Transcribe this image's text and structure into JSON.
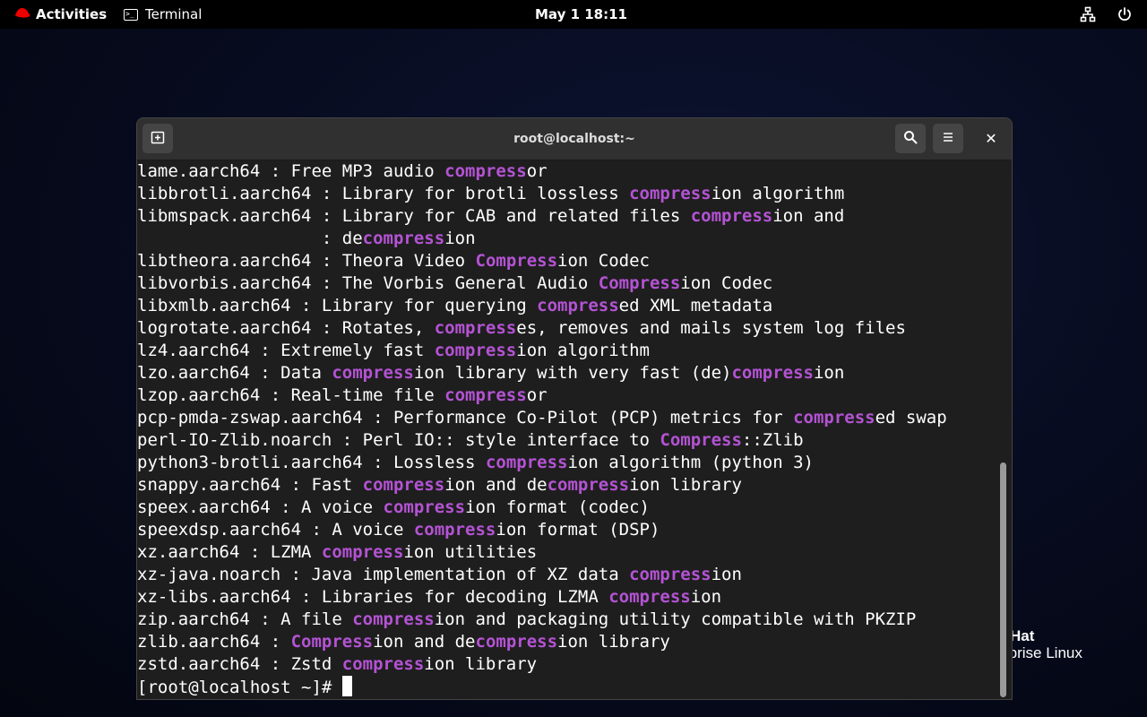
{
  "topbar": {
    "activities": "Activities",
    "app_name": "Terminal",
    "clock": "May 1  18:11"
  },
  "brand": {
    "line1": "Hat",
    "line2": "rprise Linux"
  },
  "window": {
    "title": "root@localhost:~",
    "close_glyph": "✕"
  },
  "terminal": {
    "lines": [
      [
        {
          "t": "lame.aarch64 : Free MP3 audio "
        },
        {
          "t": "compress",
          "h": 1
        },
        {
          "t": "or"
        }
      ],
      [
        {
          "t": "libbrotli.aarch64 : Library for brotli lossless "
        },
        {
          "t": "compress",
          "h": 1
        },
        {
          "t": "ion algorithm"
        }
      ],
      [
        {
          "t": "libmspack.aarch64 : Library for CAB and related files "
        },
        {
          "t": "compress",
          "h": 1
        },
        {
          "t": "ion and"
        }
      ],
      [
        {
          "t": "                  : de"
        },
        {
          "t": "compress",
          "h": 1
        },
        {
          "t": "ion"
        }
      ],
      [
        {
          "t": "libtheora.aarch64 : Theora Video "
        },
        {
          "t": "Compress",
          "h": 1
        },
        {
          "t": "ion Codec"
        }
      ],
      [
        {
          "t": "libvorbis.aarch64 : The Vorbis General Audio "
        },
        {
          "t": "Compress",
          "h": 1
        },
        {
          "t": "ion Codec"
        }
      ],
      [
        {
          "t": "libxmlb.aarch64 : Library for querying "
        },
        {
          "t": "compress",
          "h": 1
        },
        {
          "t": "ed XML metadata"
        }
      ],
      [
        {
          "t": "logrotate.aarch64 : Rotates, "
        },
        {
          "t": "compress",
          "h": 1
        },
        {
          "t": "es, removes and mails system log files"
        }
      ],
      [
        {
          "t": "lz4.aarch64 : Extremely fast "
        },
        {
          "t": "compress",
          "h": 1
        },
        {
          "t": "ion algorithm"
        }
      ],
      [
        {
          "t": "lzo.aarch64 : Data "
        },
        {
          "t": "compress",
          "h": 1
        },
        {
          "t": "ion library with very fast (de)"
        },
        {
          "t": "compress",
          "h": 1
        },
        {
          "t": "ion"
        }
      ],
      [
        {
          "t": "lzop.aarch64 : Real-time file "
        },
        {
          "t": "compress",
          "h": 1
        },
        {
          "t": "or"
        }
      ],
      [
        {
          "t": "pcp-pmda-zswap.aarch64 : Performance Co-Pilot (PCP) metrics for "
        },
        {
          "t": "compress",
          "h": 1
        },
        {
          "t": "ed swap"
        }
      ],
      [
        {
          "t": "perl-IO-Zlib.noarch : Perl IO:: style interface to "
        },
        {
          "t": "Compress",
          "h": 1
        },
        {
          "t": "::Zlib"
        }
      ],
      [
        {
          "t": "python3-brotli.aarch64 : Lossless "
        },
        {
          "t": "compress",
          "h": 1
        },
        {
          "t": "ion algorithm (python 3)"
        }
      ],
      [
        {
          "t": "snappy.aarch64 : Fast "
        },
        {
          "t": "compress",
          "h": 1
        },
        {
          "t": "ion and de"
        },
        {
          "t": "compress",
          "h": 1
        },
        {
          "t": "ion library"
        }
      ],
      [
        {
          "t": "speex.aarch64 : A voice "
        },
        {
          "t": "compress",
          "h": 1
        },
        {
          "t": "ion format (codec)"
        }
      ],
      [
        {
          "t": "speexdsp.aarch64 : A voice "
        },
        {
          "t": "compress",
          "h": 1
        },
        {
          "t": "ion format (DSP)"
        }
      ],
      [
        {
          "t": "xz.aarch64 : LZMA "
        },
        {
          "t": "compress",
          "h": 1
        },
        {
          "t": "ion utilities"
        }
      ],
      [
        {
          "t": "xz-java.noarch : Java implementation of XZ data "
        },
        {
          "t": "compress",
          "h": 1
        },
        {
          "t": "ion"
        }
      ],
      [
        {
          "t": "xz-libs.aarch64 : Libraries for decoding LZMA "
        },
        {
          "t": "compress",
          "h": 1
        },
        {
          "t": "ion"
        }
      ],
      [
        {
          "t": "zip.aarch64 : A file "
        },
        {
          "t": "compress",
          "h": 1
        },
        {
          "t": "ion and packaging utility compatible with PKZIP"
        }
      ],
      [
        {
          "t": "zlib.aarch64 : "
        },
        {
          "t": "Compress",
          "h": 1
        },
        {
          "t": "ion and de"
        },
        {
          "t": "compress",
          "h": 1
        },
        {
          "t": "ion library"
        }
      ],
      [
        {
          "t": "zstd.aarch64 : Zstd "
        },
        {
          "t": "compress",
          "h": 1
        },
        {
          "t": "ion library"
        }
      ]
    ],
    "prompt": "[root@localhost ~]# "
  },
  "colors": {
    "highlight": "#b453d4",
    "terminal_bg": "#1e1e1e"
  },
  "icons": {
    "activities": "redhat-logo-icon",
    "app": "terminal-icon",
    "network": "network-icon",
    "power": "power-icon",
    "new_tab": "new-tab-icon",
    "search": "search-icon",
    "menu": "hamburger-menu-icon",
    "close": "close-icon"
  }
}
